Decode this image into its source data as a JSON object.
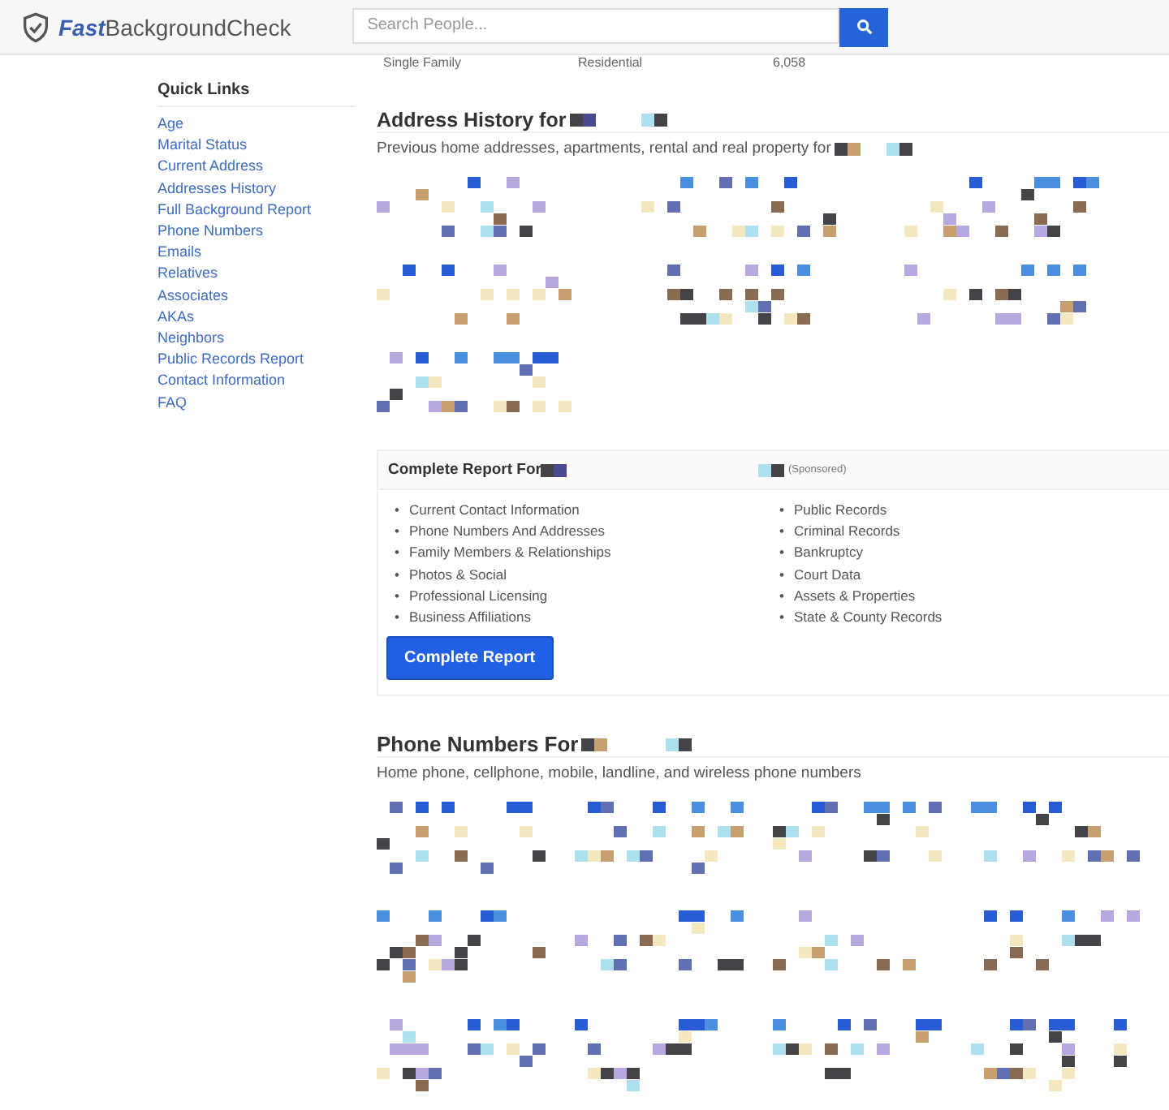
{
  "header": {
    "logo_bold": "Fast",
    "logo_rest": "BackgroundCheck",
    "search": {
      "placeholder": "Search People..."
    }
  },
  "property_row": [
    "Single Family",
    "Residential",
    "6,058"
  ],
  "quick_links": {
    "title": "Quick Links",
    "items": [
      "Age",
      "Marital Status",
      "Current Address",
      "Addresses History",
      "Full Background Report",
      "Phone Numbers",
      "Emails",
      "Relatives",
      "Associates",
      "AKAs",
      "Neighbors",
      "Public Records Report",
      "Contact Information",
      "FAQ"
    ]
  },
  "address_history": {
    "title": "Address History for",
    "subtitle": "Previous home addresses, apartments, rental and real property for",
    "records": [
      {
        "kind": "redacted"
      },
      {
        "kind": "redacted"
      },
      {
        "kind": "redacted"
      },
      {
        "kind": "redacted"
      },
      {
        "kind": "redacted"
      },
      {
        "kind": "redacted"
      },
      {
        "kind": "redacted"
      }
    ]
  },
  "complete_report": {
    "title": "Complete Report For",
    "badge": "(Sponsored)",
    "bullet": "•",
    "left_items": [
      "Current Contact Information",
      "Phone Numbers And Addresses",
      "Family Members & Relationships",
      "Photos & Social",
      "Professional Licensing",
      "Business Affiliations"
    ],
    "right_items": [
      "Public Records",
      "Criminal Records",
      "Bankruptcy",
      "Court Data",
      "Assets & Properties",
      "State & County Records"
    ],
    "button": "Complete Report"
  },
  "phone_numbers": {
    "title": "Phone Numbers For",
    "subtitle": "Home phone, cellphone, mobile, landline, and wireless phone numbers",
    "records": [
      {
        "kind": "redacted"
      },
      {
        "kind": "redacted"
      },
      {
        "kind": "redacted"
      },
      {
        "kind": "redacted"
      },
      {
        "kind": "redacted"
      },
      {
        "kind": "redacted"
      },
      {
        "kind": "redacted"
      },
      {
        "kind": "redacted"
      },
      {
        "kind": "redacted"
      },
      {
        "kind": "redacted"
      },
      {
        "kind": "redacted"
      },
      {
        "kind": "redacted"
      }
    ]
  }
}
